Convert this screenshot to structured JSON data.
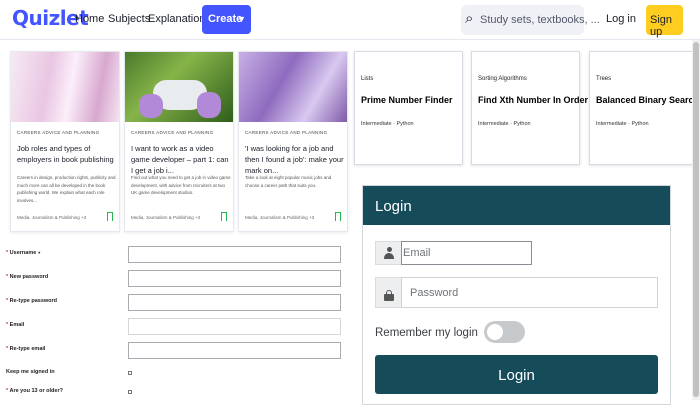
{
  "nav": {
    "logo": "Quizlet",
    "links": [
      "Home",
      "Subjects",
      "Explanations"
    ],
    "create_label": "Create",
    "search_placeholder": "Study sets, textbooks, ...",
    "login_label": "Log in",
    "signup_label": "Sign up"
  },
  "articles": [
    {
      "category": "CAREERS ADVICE AND PLANNING",
      "title": "Job roles and types of employers in book publishing",
      "description": "Careers in design, production rights, publicity and much more can all be developed in the book publishing world. We explain what each role involves...",
      "meta": "Media, Journalism & Publishing +3"
    },
    {
      "category": "CAREERS ADVICE AND PLANNING",
      "title": "I want to work as a video game developer – part 1: can I get a job i...",
      "description": "Find out what you need to get a job in video game development, with advice from recruiters at two UK game development studios.",
      "meta": "Media, Journalism & Publishing +3"
    },
    {
      "category": "CAREERS ADVICE AND PLANNING",
      "title": "'I was looking for a job and then I found a job': make your mark on...",
      "description": "Take a look at eight popular music jobs and choose a career path that suits you.",
      "meta": "Media, Journalism & Publishing +3"
    }
  ],
  "algorithms": [
    {
      "tag": "Lists",
      "title": "Prime Number Finder",
      "meta": "Intermediate · Python"
    },
    {
      "tag": "Sorting Algorithms",
      "title": "Find Xth Number In Order",
      "meta": "Intermediate · Python"
    },
    {
      "tag": "Trees",
      "title": "Balanced Binary Search Tree",
      "meta": "Intermediate · Python"
    }
  ],
  "form": {
    "username": "Username",
    "new_password": "New password",
    "retype_password": "Re-type password",
    "email": "Email",
    "retype_email": "Re-type email",
    "keep_signed_in": "Keep me signed in",
    "age_question": "Are you 13 or older?",
    "required_mark": "*",
    "info_mark": "●"
  },
  "login": {
    "header": "Login",
    "email_placeholder": "Email",
    "password_placeholder": "Password",
    "remember_label": "Remember my login",
    "button_label": "Login"
  },
  "colors": {
    "brand_blue": "#4255ff",
    "signup_yellow": "#ffcd1f",
    "login_teal": "#164b5a"
  }
}
